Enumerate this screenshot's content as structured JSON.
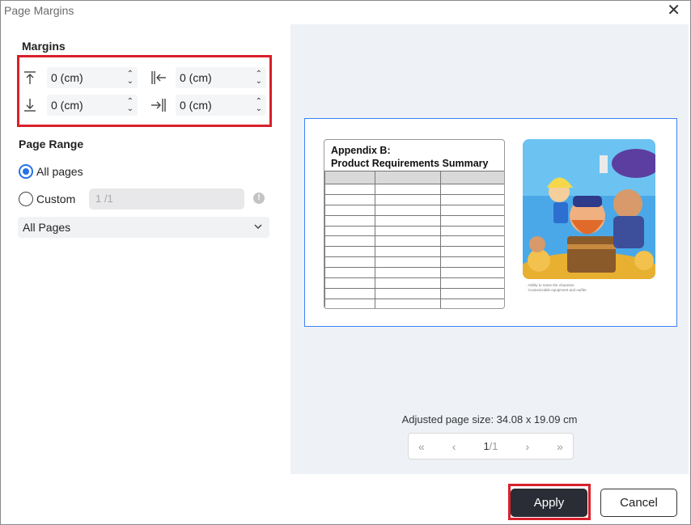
{
  "dialog": {
    "title": "Page Margins"
  },
  "margins": {
    "heading": "Margins",
    "top": "0 (cm)",
    "bottom": "0 (cm)",
    "left": "0 (cm)",
    "right": "0 (cm)"
  },
  "page_range": {
    "heading": "Page Range",
    "all_pages_label": "All pages",
    "custom_label": "Custom",
    "custom_value": "1 /1",
    "selected": "All pages",
    "dropdown_value": "All Pages"
  },
  "preview": {
    "doc_title_line1": "Appendix B:",
    "doc_title_line2": "Product Requirements Summary",
    "caption_line1": "· Ability to name the character.",
    "caption_line2": "· Customizable equipment and outfits.",
    "adjusted_size": "Adjusted page size: 34.08 x 19.09 cm",
    "page_current": "1",
    "page_total": "/1"
  },
  "buttons": {
    "apply": "Apply",
    "cancel": "Cancel"
  },
  "colors": {
    "accent": "#2471e8",
    "highlight": "#d8202a",
    "apply_bg": "#2a2d35"
  }
}
